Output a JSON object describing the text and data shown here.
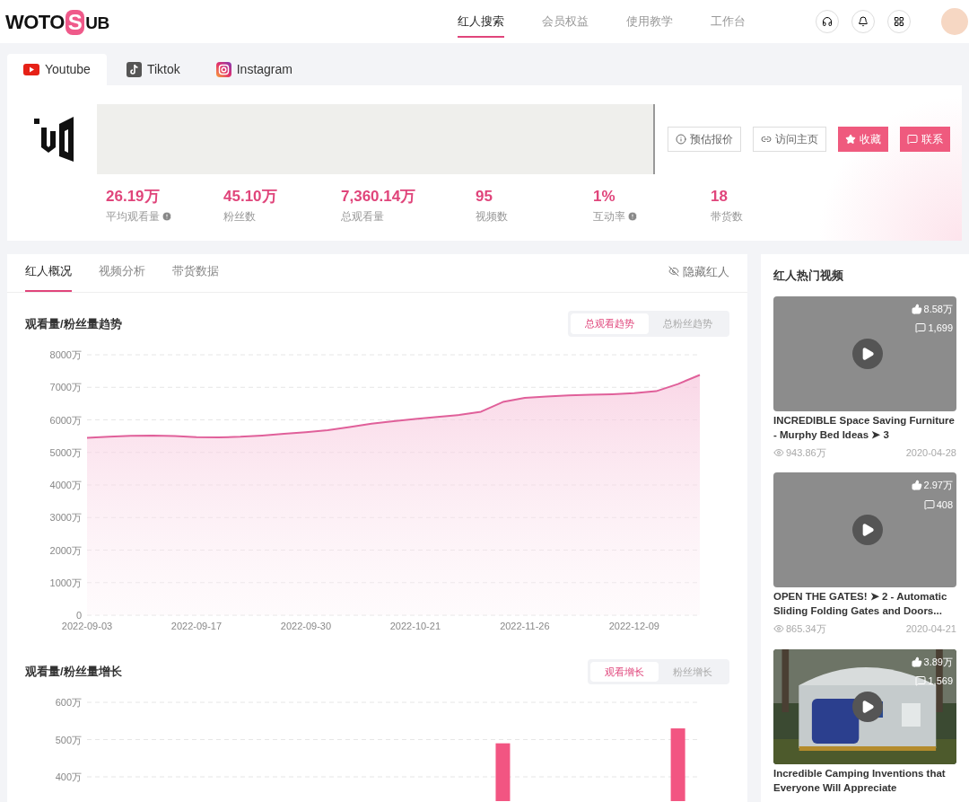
{
  "logo": {
    "left": "WOTO",
    "mark": "S",
    "right": "UB"
  },
  "nav": [
    {
      "label": "红人搜索",
      "selected": true
    },
    {
      "label": "会员权益",
      "selected": false
    },
    {
      "label": "使用教学",
      "selected": false
    },
    {
      "label": "工作台",
      "selected": false
    }
  ],
  "platform_tabs": [
    {
      "label": "Youtube",
      "kind": "youtube",
      "selected": true
    },
    {
      "label": "Tiktok",
      "kind": "tiktok",
      "selected": false
    },
    {
      "label": "Instagram",
      "kind": "instagram",
      "selected": false
    }
  ],
  "profile": {
    "actions": [
      {
        "label": "预估报价",
        "kind": "info",
        "primary": false
      },
      {
        "label": "访问主页",
        "kind": "link",
        "primary": false
      },
      {
        "label": "收藏",
        "kind": "star",
        "primary": true
      },
      {
        "label": "联系",
        "kind": "message",
        "primary": true
      }
    ],
    "stats": [
      {
        "value": "26.19万",
        "label": "平均观看量",
        "info": true
      },
      {
        "value": "45.10万",
        "label": "粉丝数",
        "info": false
      },
      {
        "value": "7,360.14万",
        "label": "总观看量",
        "info": false
      },
      {
        "value": "95",
        "label": "视频数",
        "info": false
      },
      {
        "value": "1%",
        "label": "互动率",
        "info": true
      },
      {
        "value": "18",
        "label": "带货数",
        "info": false
      }
    ]
  },
  "detail_tabs": [
    {
      "label": "红人概况",
      "selected": true
    },
    {
      "label": "视频分析",
      "selected": false
    },
    {
      "label": "带货数据",
      "selected": false
    }
  ],
  "hide_button": "隐藏红人",
  "trend": {
    "title": "观看量/粉丝量趋势",
    "toggles": [
      {
        "label": "总观看趋势",
        "selected": true
      },
      {
        "label": "总粉丝趋势",
        "selected": false
      }
    ],
    "chart_data": {
      "type": "area",
      "categories": [
        "2022-09-03",
        null,
        null,
        null,
        null,
        "2022-09-17",
        null,
        null,
        null,
        null,
        "2022-09-30",
        null,
        null,
        null,
        null,
        "2022-10-21",
        null,
        null,
        null,
        null,
        "2022-11-26",
        null,
        null,
        null,
        null,
        "2022-12-09",
        null,
        null,
        null
      ],
      "series": [
        {
          "color": "#e0609a",
          "values": [
            5450,
            5480,
            5510,
            5520,
            5500,
            5470,
            5460,
            5480,
            5520,
            5570,
            5620,
            5680,
            5780,
            5880,
            5960,
            6030,
            6090,
            6150,
            6250,
            6550,
            6680,
            6720,
            6750,
            6770,
            6790,
            6820,
            6880,
            7100,
            7380
          ]
        }
      ],
      "ylim": [
        0,
        8000
      ],
      "grid": true,
      "yticks": [
        {
          "value": 0,
          "label": "0"
        },
        {
          "value": 1000,
          "label": "1000万"
        },
        {
          "value": 2000,
          "label": "2000万"
        },
        {
          "value": 3000,
          "label": "3000万"
        },
        {
          "value": 4000,
          "label": "4000万"
        },
        {
          "value": 5000,
          "label": "5000万"
        },
        {
          "value": 6000,
          "label": "6000万"
        },
        {
          "value": 7000,
          "label": "7000万"
        },
        {
          "value": 8000,
          "label": "8000万"
        }
      ]
    }
  },
  "growth": {
    "title": "观看量/粉丝量增长",
    "toggles": [
      {
        "label": "观看增长",
        "selected": true
      },
      {
        "label": "粉丝增长",
        "selected": false
      }
    ],
    "chart_data": {
      "type": "bar",
      "categories": [
        null,
        null,
        null,
        null,
        null,
        null,
        null,
        null,
        null,
        null,
        null,
        null,
        null,
        null,
        null,
        null,
        null,
        null,
        null,
        null,
        null,
        null,
        null,
        null,
        null,
        null,
        null,
        null,
        null
      ],
      "series": [
        {
          "color": "#f25582",
          "values": [
            null,
            null,
            null,
            null,
            null,
            null,
            null,
            null,
            null,
            null,
            null,
            null,
            null,
            null,
            null,
            null,
            null,
            null,
            null,
            490,
            null,
            null,
            null,
            null,
            null,
            null,
            null,
            530,
            null
          ]
        }
      ],
      "grid": true,
      "ylim": [
        0,
        600
      ],
      "yticks": [
        {
          "value": 400,
          "label": "400万"
        },
        {
          "value": 500,
          "label": "500万"
        },
        {
          "value": 600,
          "label": "600万"
        }
      ]
    }
  },
  "hot_videos": {
    "title": "红人热门视频",
    "items": [
      {
        "kind": "placeholder",
        "likes": "8.58万",
        "comments": "1,699",
        "title": "INCREDIBLE Space Saving Furniture - Murphy Bed Ideas ➤ 3",
        "views": "943.86万",
        "date": "2020-04-28"
      },
      {
        "kind": "placeholder",
        "likes": "2.97万",
        "comments": "408",
        "title": "OPEN THE GATES! ➤ 2 - Automatic Sliding Folding Gates and Doors...",
        "views": "865.34万",
        "date": "2020-04-21"
      },
      {
        "kind": "picture",
        "likes": "3.89万",
        "comments": "1,569",
        "title": "Incredible Camping Inventions that Everyone Will Appreciate"
      }
    ]
  }
}
